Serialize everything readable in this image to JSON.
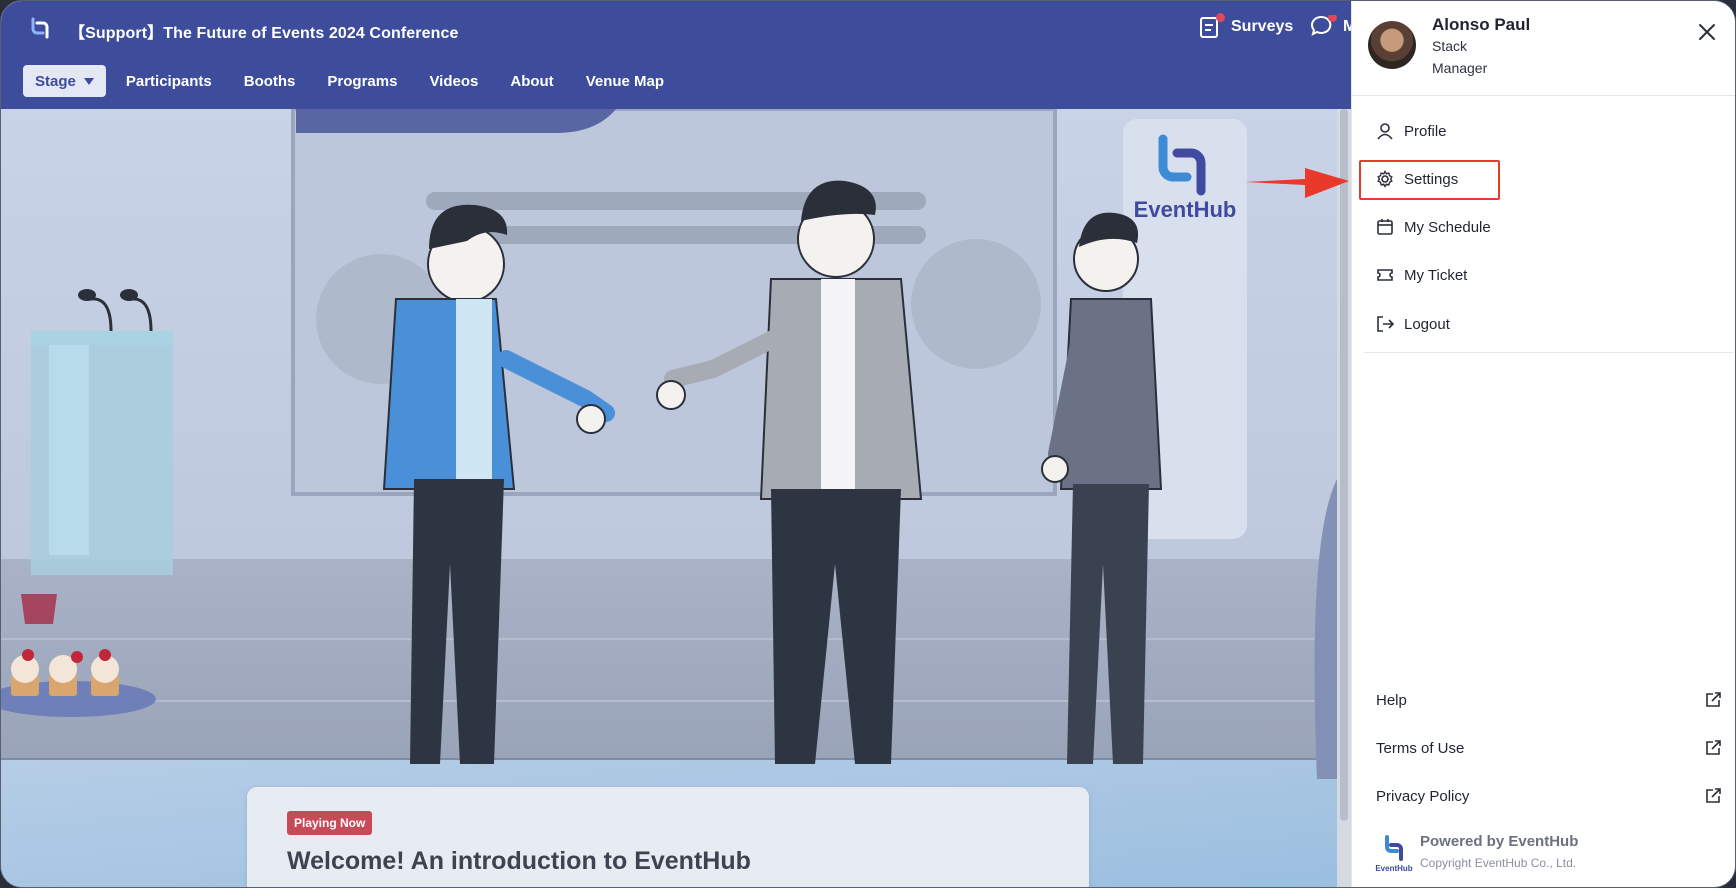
{
  "header": {
    "event_title": "【Support】The Future of Events 2024 Conference",
    "surveys_label": "Surveys",
    "messages_label": "M"
  },
  "nav": {
    "stage_label": "Stage",
    "items": [
      "Participants",
      "Booths",
      "Programs",
      "Videos",
      "About",
      "Venue Map"
    ]
  },
  "stage": {
    "booth_brand": "EventHub"
  },
  "card": {
    "badge": "Playing Now",
    "title": "Welcome! An introduction to EventHub"
  },
  "profile": {
    "name": "Alonso Paul",
    "company": "Stack",
    "role": "Manager"
  },
  "menu": {
    "profile": "Profile",
    "settings": "Settings",
    "schedule": "My Schedule",
    "ticket": "My Ticket",
    "logout": "Logout"
  },
  "links": {
    "help": "Help",
    "terms": "Terms of Use",
    "privacy": "Privacy Policy"
  },
  "footer": {
    "powered": "Powered by EventHub",
    "copyright": "Copyright EventHub Co., Ltd.",
    "logo_text": "EventHub"
  },
  "colors": {
    "header_bg": "#3d4d9b",
    "highlight": "#e8392a",
    "badge": "#c64a57"
  }
}
